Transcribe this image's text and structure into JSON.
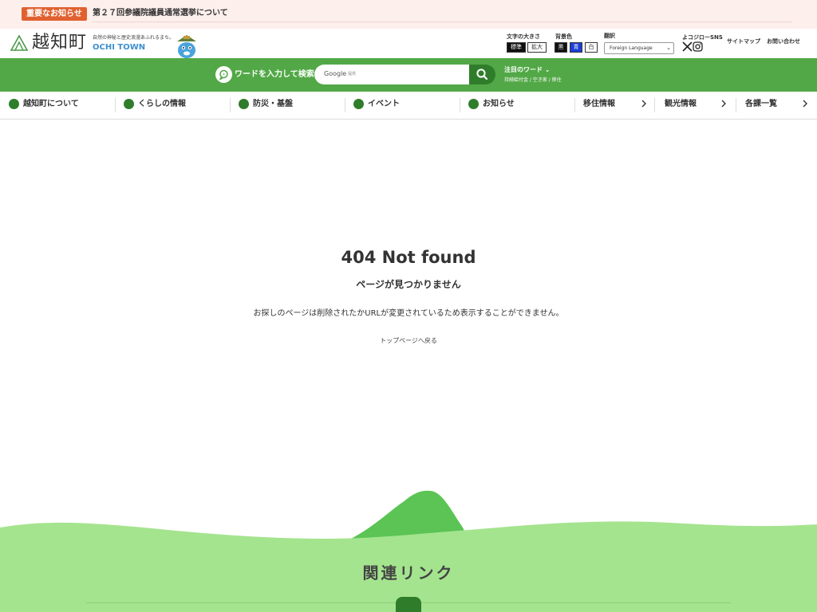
{
  "notice": {
    "badge": "重要なお知らせ",
    "link": "第２７回参議院議員通常選挙について"
  },
  "header": {
    "logo_text": "越知町",
    "tagline": "自然の神秘と歴史浪漫あふれるまち。",
    "town_en": "OCHI TOWN",
    "text_size_label": "文字の大きさ",
    "text_size_standard": "標準",
    "text_size_large": "拡大",
    "bg_color_label": "背景色",
    "bg_black": "黒",
    "bg_blue": "青",
    "bg_white": "白",
    "translate_label": "翻訳",
    "language_select": "Foreign Language",
    "sns_label": "よコジローSNS",
    "sitemap": "サイトマップ",
    "contact": "お問い合わせ"
  },
  "search": {
    "prompt": "ワードを入力して検索",
    "google": "Google",
    "placeholder": "提供",
    "hot_title": "注目のワード",
    "hot_words": "持続給付金 / 空き家 / 移住"
  },
  "nav": {
    "items": [
      {
        "label": "越知町について"
      },
      {
        "label": "くらしの情報"
      },
      {
        "label": "防災・基盤"
      },
      {
        "label": "イベント"
      },
      {
        "label": "お知らせ"
      },
      {
        "label": "移住情報"
      },
      {
        "label": "観光情報"
      },
      {
        "label": "各課一覧"
      }
    ]
  },
  "error": {
    "title": "404 Not found",
    "subtitle": "ページが見つかりません",
    "description": "お探しのページは削除されたかURLが変更されているため表示することができません。",
    "back_link": "トップページへ戻る"
  },
  "footer": {
    "related_title": "関連リンク"
  },
  "colors": {
    "brand_green": "#52a846",
    "dark_green": "#2f7d2a",
    "notice_orange": "#e0612f",
    "hill_light": "#a4e48e"
  }
}
